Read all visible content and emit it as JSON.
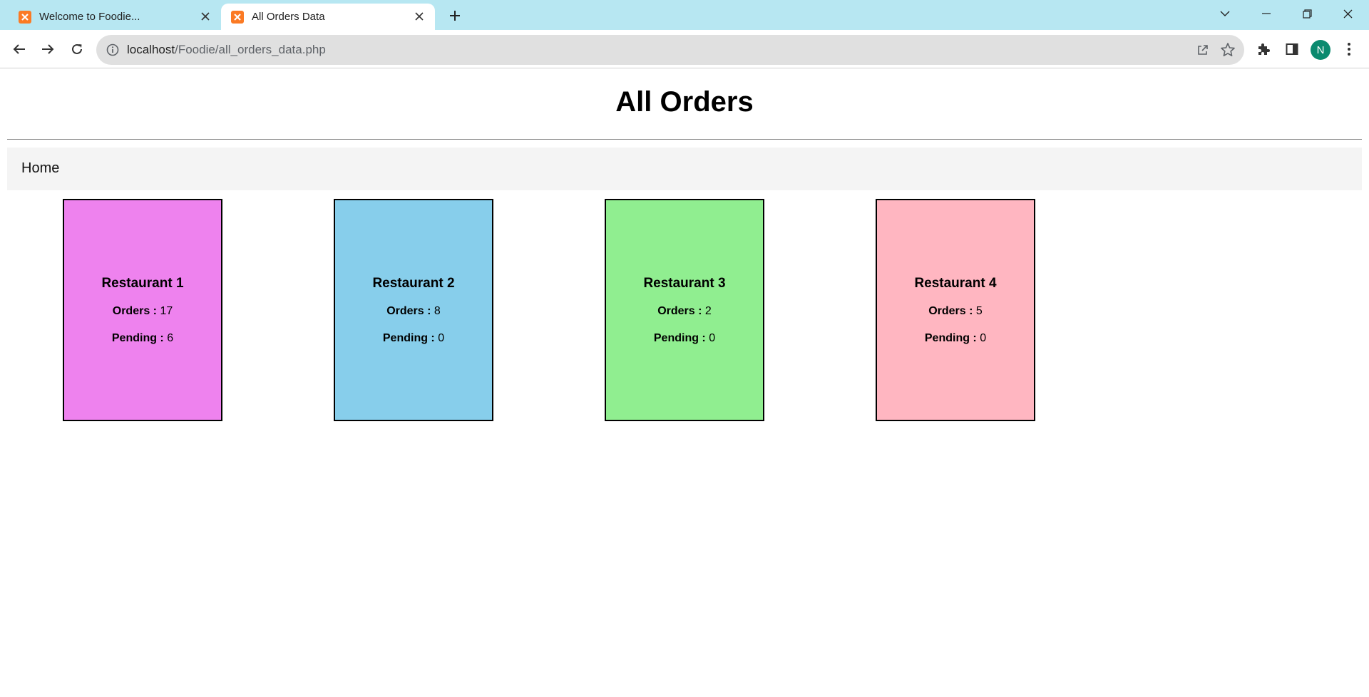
{
  "browser": {
    "tabs": [
      {
        "title": "Welcome to Foodie...",
        "active": false
      },
      {
        "title": "All Orders Data",
        "active": true
      }
    ],
    "url_host": "localhost",
    "url_path": "/Foodie/all_orders_data.php",
    "profile_initial": "N",
    "colors": {
      "tabbar": "#b7e7f2",
      "favicon": "#fb7a24",
      "avatar": "#0b8a6f"
    }
  },
  "page": {
    "title": "All Orders",
    "nav": {
      "home_label": "Home"
    },
    "orders_label": "Orders :",
    "pending_label": "Pending :",
    "restaurants": [
      {
        "name": "Restaurant 1",
        "orders": "17",
        "pending": "6",
        "color": "#ee82ee"
      },
      {
        "name": "Restaurant 2",
        "orders": "8",
        "pending": "0",
        "color": "#87ceeb"
      },
      {
        "name": "Restaurant 3",
        "orders": "2",
        "pending": "0",
        "color": "#90ee90"
      },
      {
        "name": "Restaurant 4",
        "orders": "5",
        "pending": "0",
        "color": "#ffb6c1"
      }
    ]
  }
}
